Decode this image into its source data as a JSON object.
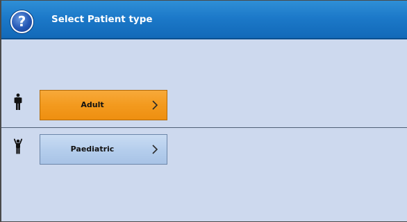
{
  "dialog": {
    "title": "Select Patient type",
    "help_icon": "question-mark-icon",
    "help_glyph": "?"
  },
  "options": [
    {
      "label": "Adult",
      "icon": "adult-person-icon",
      "state": "selected",
      "color": "#f39a1e"
    },
    {
      "label": "Paediatric",
      "icon": "child-person-icon",
      "state": "unselected",
      "color": "#b4cdec"
    }
  ],
  "colors": {
    "titlebar": "#1c79c9",
    "background": "#cdd9ee",
    "title_text": "#ffffff"
  }
}
